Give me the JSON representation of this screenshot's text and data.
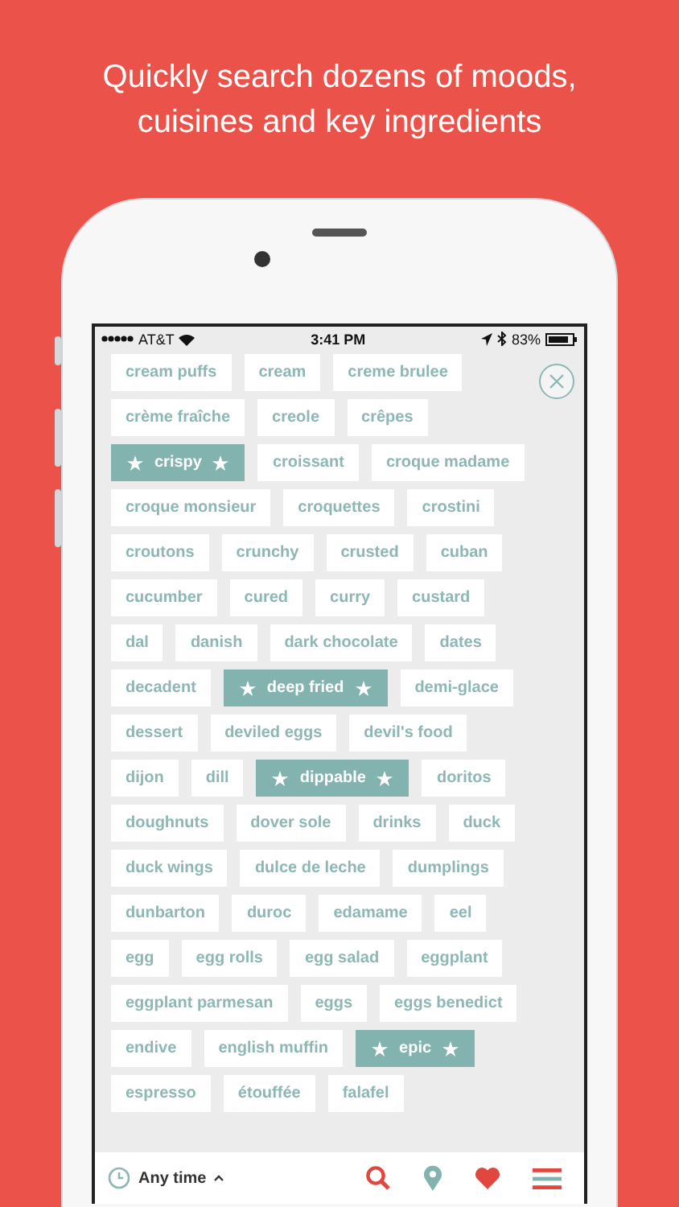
{
  "headline": "Quickly search dozens of moods, cuisines and key ingredients",
  "status_bar": {
    "carrier": "AT&T",
    "time": "3:41 PM",
    "battery": "83%"
  },
  "tag_rows": [
    [
      {
        "label": "cream puffs",
        "selected": false
      },
      {
        "label": "cream",
        "selected": false
      },
      {
        "label": "creme brulee",
        "selected": false
      }
    ],
    [
      {
        "label": "crème fraîche",
        "selected": false
      },
      {
        "label": "creole",
        "selected": false
      },
      {
        "label": "crêpes",
        "selected": false
      }
    ],
    [
      {
        "label": "crispy",
        "selected": true
      },
      {
        "label": "croissant",
        "selected": false
      },
      {
        "label": "croque madame",
        "selected": false
      }
    ],
    [
      {
        "label": "croque monsieur",
        "selected": false
      },
      {
        "label": "croquettes",
        "selected": false
      },
      {
        "label": "crostini",
        "selected": false
      }
    ],
    [
      {
        "label": "croutons",
        "selected": false
      },
      {
        "label": "crunchy",
        "selected": false
      },
      {
        "label": "crusted",
        "selected": false
      },
      {
        "label": "cuban",
        "selected": false
      }
    ],
    [
      {
        "label": "cucumber",
        "selected": false
      },
      {
        "label": "cured",
        "selected": false
      },
      {
        "label": "curry",
        "selected": false
      },
      {
        "label": "custard",
        "selected": false
      }
    ],
    [
      {
        "label": "dal",
        "selected": false
      },
      {
        "label": "danish",
        "selected": false
      },
      {
        "label": "dark chocolate",
        "selected": false
      },
      {
        "label": "dates",
        "selected": false
      }
    ],
    [
      {
        "label": "decadent",
        "selected": false
      },
      {
        "label": "deep fried",
        "selected": true
      },
      {
        "label": "demi-glace",
        "selected": false
      }
    ],
    [
      {
        "label": "dessert",
        "selected": false
      },
      {
        "label": "deviled eggs",
        "selected": false
      },
      {
        "label": "devil's food",
        "selected": false
      }
    ],
    [
      {
        "label": "dijon",
        "selected": false
      },
      {
        "label": "dill",
        "selected": false
      },
      {
        "label": "dippable",
        "selected": true
      },
      {
        "label": "doritos",
        "selected": false
      }
    ],
    [
      {
        "label": "doughnuts",
        "selected": false
      },
      {
        "label": "dover sole",
        "selected": false
      },
      {
        "label": "drinks",
        "selected": false
      },
      {
        "label": "duck",
        "selected": false
      }
    ],
    [
      {
        "label": "duck wings",
        "selected": false
      },
      {
        "label": "dulce de leche",
        "selected": false
      },
      {
        "label": "dumplings",
        "selected": false
      }
    ],
    [
      {
        "label": "dunbarton",
        "selected": false
      },
      {
        "label": "duroc",
        "selected": false
      },
      {
        "label": "edamame",
        "selected": false
      },
      {
        "label": "eel",
        "selected": false
      }
    ],
    [
      {
        "label": "egg",
        "selected": false
      },
      {
        "label": "egg rolls",
        "selected": false
      },
      {
        "label": "egg salad",
        "selected": false
      },
      {
        "label": "eggplant",
        "selected": false
      }
    ],
    [
      {
        "label": "eggplant parmesan",
        "selected": false
      },
      {
        "label": "eggs",
        "selected": false
      },
      {
        "label": "eggs benedict",
        "selected": false
      }
    ],
    [
      {
        "label": "endive",
        "selected": false
      },
      {
        "label": "english muffin",
        "selected": false
      },
      {
        "label": "epic",
        "selected": true
      }
    ],
    [
      {
        "label": "espresso",
        "selected": false
      },
      {
        "label": "étouffée",
        "selected": false
      },
      {
        "label": "falafel",
        "selected": false
      }
    ]
  ],
  "bottom_bar": {
    "time_filter": "Any time"
  }
}
